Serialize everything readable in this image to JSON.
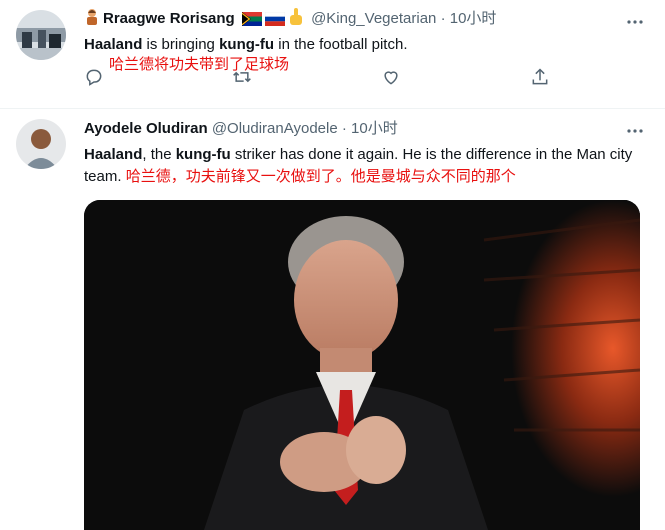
{
  "tweets": [
    {
      "display_name": "Rraagwe Rorisang",
      "handle": "@King_Vegetarian",
      "separator": "·",
      "time": "10小时",
      "text_parts": [
        "Haaland",
        " is bringing ",
        "kung-fu",
        " in the football pitch."
      ],
      "annotation": "哈兰德将功夫带到了足球场",
      "actions": [
        "reply-icon",
        "retweet-icon",
        "like-icon",
        "share-icon"
      ]
    },
    {
      "display_name": "Ayodele Oludiran",
      "handle": "@OludiranAyodele",
      "separator": "·",
      "time": "10小时",
      "text_parts": [
        "Haaland",
        ", the ",
        "kung-fu",
        " striker has done it again. He is the difference in the Man city team."
      ],
      "annotation": "哈兰德，功夫前锋又一次做到了。他是曼城与众不同的那个",
      "media": "gif-thumbnail"
    }
  ],
  "colors": {
    "annotation": "#e8100f",
    "secondary_text": "#536471",
    "divider": "#eff3f4"
  }
}
